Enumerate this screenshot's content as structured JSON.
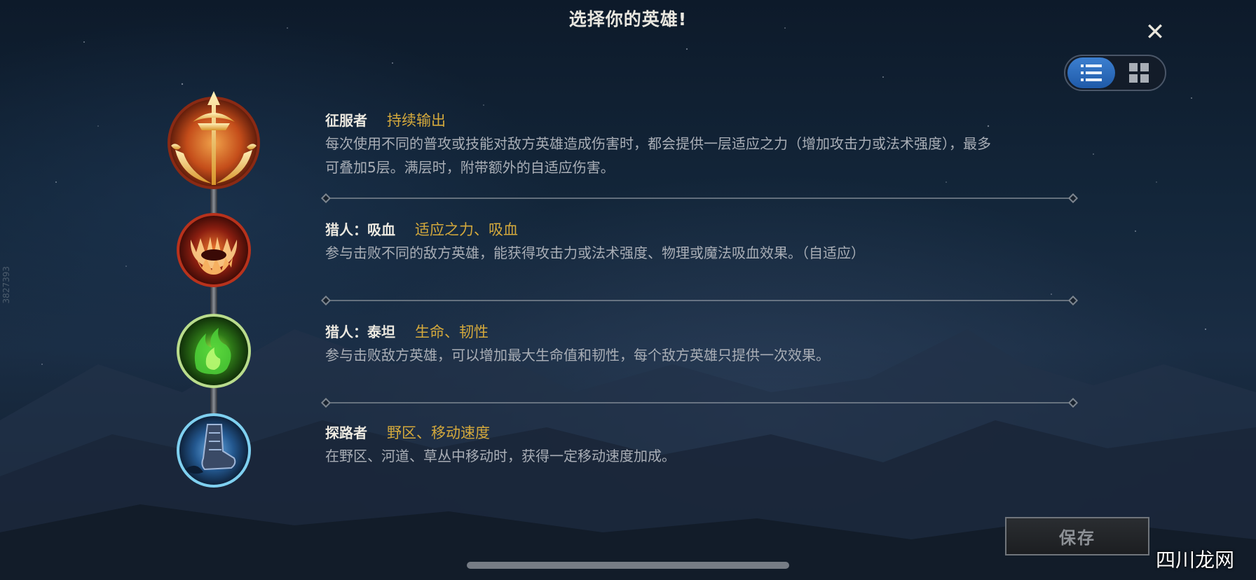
{
  "header": {
    "title": "选择你的英雄!"
  },
  "controls": {
    "close_icon": "close-icon",
    "view_toggle": {
      "options": [
        "list-view",
        "grid-view"
      ],
      "selected": "list-view"
    }
  },
  "runes": [
    {
      "name": "征服者",
      "tag": "持续输出",
      "description": "每次使用不同的普攻或技能对敌方英雄造成伤害时，都会提供一层适应之力（增加攻击力或法术强度），最多可叠加5层。满层时，附带额外的自适应伤害。",
      "description_line1": "每次使用不同的普攻或技能对敌方英雄造成伤害时，都会提供一层适应之力（增加攻击力或法术强度），最多",
      "description_line2": "可叠加5层。满层时，附带额外的自适应伤害。",
      "icon": "conqueror-icon",
      "accent": "#c9541f"
    },
    {
      "name": "猎人：吸血",
      "tag": "适应之力、吸血",
      "description": "参与击败不同的敌方英雄，能获得攻击力或法术强度、物理或魔法吸血效果。（自适应）",
      "icon": "bloodsucker-fangs-icon",
      "accent": "#b8321c"
    },
    {
      "name": "猎人：泰坦",
      "tag": "生命、韧性",
      "description": "参与击败敌方英雄，可以增加最大生命值和韧性，每个敌方英雄只提供一次效果。",
      "icon": "titan-green-flame-icon",
      "accent": "#5fb336"
    },
    {
      "name": "探路者",
      "tag": "野区、移动速度",
      "description": "在野区、河道、草丛中移动时，获得一定移动速度加成。",
      "icon": "pathfinder-boot-icon",
      "accent": "#3f8fd8"
    }
  ],
  "footer": {
    "save_label": "保存"
  },
  "watermark": "四川龙网",
  "side_id": "3827393",
  "colors": {
    "tag": "#d4a93c",
    "title": "#e8e6df",
    "description": "#a9aeb6",
    "toggle_active": "#2d6fc0"
  }
}
